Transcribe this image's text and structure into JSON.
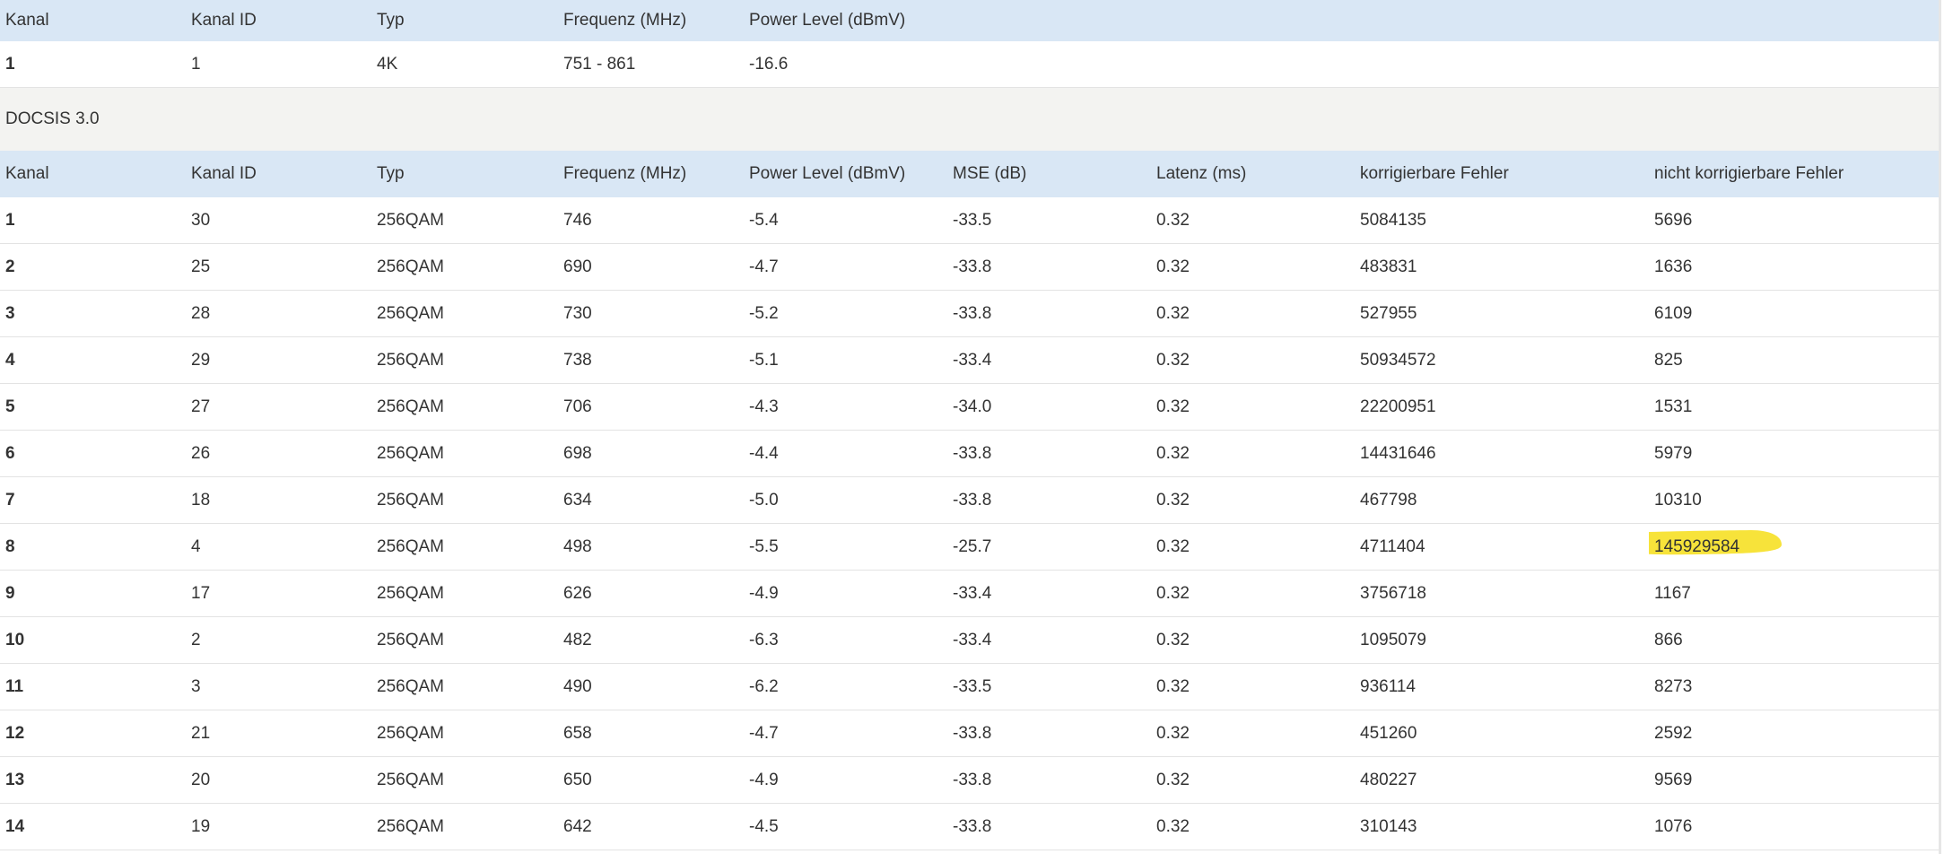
{
  "ofdm_table": {
    "headers": [
      "Kanal",
      "Kanal ID",
      "Typ",
      "Frequenz (MHz)",
      "Power Level (dBmV)"
    ],
    "rows": [
      [
        "1",
        "1",
        "4K",
        "751 - 861",
        "-16.6"
      ]
    ]
  },
  "docsis30": {
    "section_title": "DOCSIS 3.0",
    "headers": [
      "Kanal",
      "Kanal ID",
      "Typ",
      "Frequenz (MHz)",
      "Power Level (dBmV)",
      "MSE (dB)",
      "Latenz (ms)",
      "korrigierbare Fehler",
      "nicht korrigierbare Fehler"
    ],
    "rows": [
      [
        "1",
        "30",
        "256QAM",
        "746",
        "-5.4",
        "-33.5",
        "0.32",
        "5084135",
        "5696"
      ],
      [
        "2",
        "25",
        "256QAM",
        "690",
        "-4.7",
        "-33.8",
        "0.32",
        "483831",
        "1636"
      ],
      [
        "3",
        "28",
        "256QAM",
        "730",
        "-5.2",
        "-33.8",
        "0.32",
        "527955",
        "6109"
      ],
      [
        "4",
        "29",
        "256QAM",
        "738",
        "-5.1",
        "-33.4",
        "0.32",
        "50934572",
        "825"
      ],
      [
        "5",
        "27",
        "256QAM",
        "706",
        "-4.3",
        "-34.0",
        "0.32",
        "22200951",
        "1531"
      ],
      [
        "6",
        "26",
        "256QAM",
        "698",
        "-4.4",
        "-33.8",
        "0.32",
        "14431646",
        "5979"
      ],
      [
        "7",
        "18",
        "256QAM",
        "634",
        "-5.0",
        "-33.8",
        "0.32",
        "467798",
        "10310"
      ],
      [
        "8",
        "4",
        "256QAM",
        "498",
        "-5.5",
        "-25.7",
        "0.32",
        "4711404",
        "145929584"
      ],
      [
        "9",
        "17",
        "256QAM",
        "626",
        "-4.9",
        "-33.4",
        "0.32",
        "3756718",
        "1167"
      ],
      [
        "10",
        "2",
        "256QAM",
        "482",
        "-6.3",
        "-33.4",
        "0.32",
        "1095079",
        "866"
      ],
      [
        "11",
        "3",
        "256QAM",
        "490",
        "-6.2",
        "-33.5",
        "0.32",
        "936114",
        "8273"
      ],
      [
        "12",
        "21",
        "256QAM",
        "658",
        "-4.7",
        "-33.8",
        "0.32",
        "451260",
        "2592"
      ],
      [
        "13",
        "20",
        "256QAM",
        "650",
        "-4.9",
        "-33.8",
        "0.32",
        "480227",
        "9569"
      ],
      [
        "14",
        "19",
        "256QAM",
        "642",
        "-4.5",
        "-33.8",
        "0.32",
        "310143",
        "1076"
      ]
    ],
    "highlighted_row_index": 7,
    "highlighted_column_index": 8
  },
  "colors": {
    "header_bg": "#d9e7f5",
    "section_bg": "#f3f3f1",
    "row_border": "#e3e3e3",
    "highlight": "#f7e33a",
    "text": "#333333"
  }
}
